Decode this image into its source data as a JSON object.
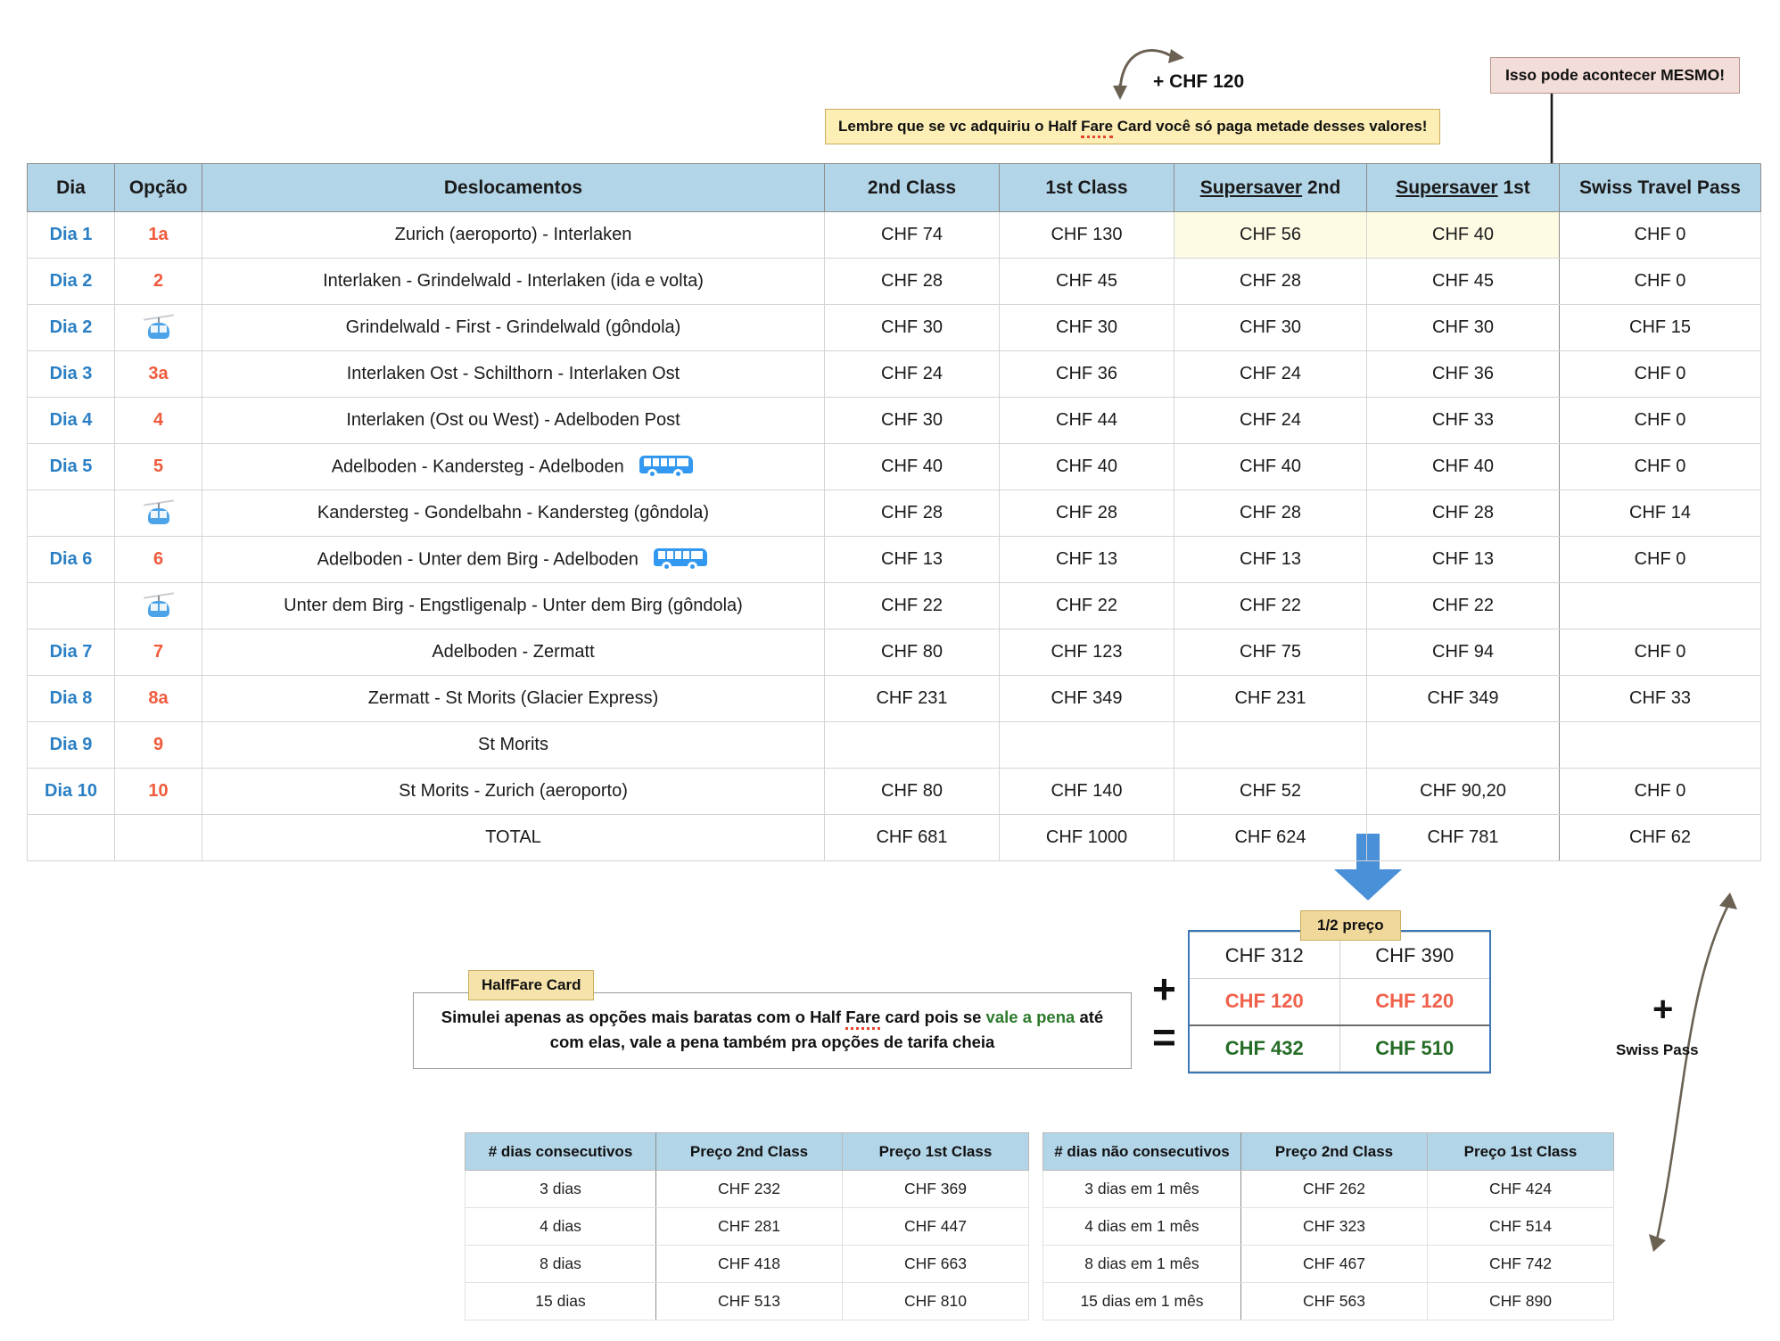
{
  "annotations": {
    "plus_chf_120": "+ CHF 120",
    "yellow_note": {
      "pre": "Lembre que se vc adquiriu o Half ",
      "spell": "Fare",
      "post": " Card você só paga metade desses valores!"
    },
    "pink_note": "Isso pode acontecer MESMO!",
    "half_price_tag": "1/2 preço",
    "halffare_tag": "HalfFare Card",
    "halffare_note": {
      "l1_pre": "Simulei apenas as opções mais baratas com o Half ",
      "l1_spell": "Fare",
      "l1_mid": " card pois se ",
      "l1_green": "vale a",
      "l2_green": "pena",
      "l2_post": " até com elas, vale a pena também pra opções de tarifa cheia"
    },
    "swiss_pass_label": "Swiss Pass",
    "plus_symbol": "+",
    "equals_symbol": "="
  },
  "main_table": {
    "headers": [
      "Dia",
      "Opção",
      "Deslocamentos",
      "2nd Class",
      "1st Class",
      "Supersaver 2nd",
      "Supersaver 1st",
      "Swiss Travel Pass"
    ],
    "header_parts": {
      "supersaver_2nd": {
        "ul": "Supersaver",
        "rest": " 2nd"
      },
      "supersaver_1st": {
        "ul": "Supersaver",
        "rest": " 1st"
      }
    },
    "rows": [
      {
        "dia": "Dia 1",
        "opcao": "1a",
        "icon": "",
        "desloc": "Zurich (aeroporto) - Interlaken",
        "c2nd": "CHF 74",
        "c1st": "CHF 130",
        "ss2nd": "CHF 56",
        "ss1st": "CHF 40",
        "stp": "CHF 0",
        "highlight": true
      },
      {
        "dia": "Dia 2",
        "opcao": "2",
        "icon": "",
        "desloc": "Interlaken - Grindelwald - Interlaken (ida e volta)",
        "c2nd": "CHF 28",
        "c1st": "CHF 45",
        "ss2nd": "CHF 28",
        "ss1st": "CHF 45",
        "stp": "CHF 0",
        "highlight": false
      },
      {
        "dia": "Dia 2",
        "opcao": "",
        "icon": "gondola",
        "desloc": "Grindelwald - First - Grindelwald (gôndola)",
        "c2nd": "CHF 30",
        "c1st": "CHF 30",
        "ss2nd": "CHF 30",
        "ss1st": "CHF 30",
        "stp": "CHF 15",
        "highlight": false
      },
      {
        "dia": "Dia 3",
        "opcao": "3a",
        "icon": "",
        "desloc": "Interlaken Ost - Schilthorn - Interlaken Ost",
        "c2nd": "CHF 24",
        "c1st": "CHF 36",
        "ss2nd": "CHF 24",
        "ss1st": "CHF 36",
        "stp": "CHF 0",
        "highlight": false
      },
      {
        "dia": "Dia 4",
        "opcao": "4",
        "icon": "",
        "desloc": "Interlaken (Ost ou West) - Adelboden Post",
        "c2nd": "CHF 30",
        "c1st": "CHF 44",
        "ss2nd": "CHF 24",
        "ss1st": "CHF 33",
        "stp": "CHF 0",
        "highlight": false
      },
      {
        "dia": "Dia 5",
        "opcao": "5",
        "icon": "",
        "desloc": "Adelboden - Kandersteg - Adelboden",
        "desloc_icon": "bus",
        "c2nd": "CHF 40",
        "c1st": "CHF 40",
        "ss2nd": "CHF 40",
        "ss1st": "CHF 40",
        "stp": "CHF 0",
        "highlight": false
      },
      {
        "dia": "",
        "opcao": "",
        "icon": "gondola",
        "desloc": "Kandersteg - Gondelbahn - Kandersteg (gôndola)",
        "c2nd": "CHF 28",
        "c1st": "CHF 28",
        "ss2nd": "CHF 28",
        "ss1st": "CHF 28",
        "stp": "CHF 14",
        "highlight": false
      },
      {
        "dia": "Dia 6",
        "opcao": "6",
        "icon": "",
        "desloc": "Adelboden - Unter dem Birg - Adelboden",
        "desloc_icon": "bus",
        "c2nd": "CHF 13",
        "c1st": "CHF 13",
        "ss2nd": "CHF 13",
        "ss1st": "CHF 13",
        "stp": "CHF 0",
        "highlight": false
      },
      {
        "dia": "",
        "opcao": "",
        "icon": "gondola",
        "desloc": "Unter dem Birg - Engstligenalp - Unter dem Birg (gôndola)",
        "c2nd": "CHF 22",
        "c1st": "CHF 22",
        "ss2nd": "CHF 22",
        "ss1st": "CHF 22",
        "stp": "",
        "highlight": false
      },
      {
        "dia": "Dia 7",
        "opcao": "7",
        "icon": "",
        "desloc": "Adelboden - Zermatt",
        "c2nd": "CHF 80",
        "c1st": "CHF 123",
        "ss2nd": "CHF 75",
        "ss1st": "CHF 94",
        "stp": "CHF 0",
        "highlight": false
      },
      {
        "dia": "Dia 8",
        "opcao": "8a",
        "icon": "",
        "desloc": "Zermatt - St Morits (Glacier Express)",
        "c2nd": "CHF 231",
        "c1st": "CHF 349",
        "ss2nd": "CHF 231",
        "ss1st": "CHF 349",
        "stp": "CHF 33",
        "highlight": false
      },
      {
        "dia": "Dia 9",
        "opcao": "9",
        "icon": "",
        "desloc": "St Morits",
        "c2nd": "",
        "c1st": "",
        "ss2nd": "",
        "ss1st": "",
        "stp": "",
        "highlight": false
      },
      {
        "dia": "Dia 10",
        "opcao": "10",
        "icon": "",
        "desloc": "St Morits - Zurich (aeroporto)",
        "c2nd": "CHF 80",
        "c1st": "CHF 140",
        "ss2nd": "CHF 52",
        "ss1st": "CHF 90,20",
        "stp": "CHF 0",
        "highlight": false
      }
    ],
    "total": {
      "label": "TOTAL",
      "c2nd": "CHF 681",
      "c1st": "CHF 1000",
      "ss2nd": "CHF 624",
      "ss1st": "CHF 781",
      "stp": "CHF 62"
    }
  },
  "half_price_box": {
    "half_2nd": "CHF 312",
    "half_1st": "CHF 390",
    "card_2nd": "CHF 120",
    "card_1st": "CHF 120",
    "sum_2nd": "CHF 432",
    "sum_1st": "CHF 510"
  },
  "table_consecutivos": {
    "headers": [
      "# dias consecutivos",
      "Preço 2nd Class",
      "Preço 1st Class"
    ],
    "rows": [
      [
        "3 dias",
        "CHF 232",
        "CHF 369"
      ],
      [
        "4 dias",
        "CHF 281",
        "CHF 447"
      ],
      [
        "8 dias",
        "CHF 418",
        "CHF 663"
      ],
      [
        "15 dias",
        "CHF 513",
        "CHF 810"
      ]
    ]
  },
  "table_nao_consecutivos": {
    "headers": [
      "# dias não consecutivos",
      "Preço 2nd Class",
      "Preço 1st Class"
    ],
    "rows": [
      [
        "3 dias em 1 mês",
        "CHF 262",
        "CHF 424"
      ],
      [
        "4 dias em 1 mês",
        "CHF 323",
        "CHF 514"
      ],
      [
        "8 dias em 1 mês",
        "CHF 467",
        "CHF 742"
      ],
      [
        "15 dias em 1 mês",
        "CHF 563",
        "CHF 890"
      ]
    ]
  },
  "colors": {
    "header_blue": "#b3d5e8",
    "day_blue": "#2a7fc4",
    "option_orange": "#f05b3c",
    "total_brown": "#8a3a12",
    "note_yellow": "#fdeeb5",
    "note_pink": "#f3ddd8",
    "green": "#2d7a2d",
    "arrow_blue": "#4a90d9"
  }
}
